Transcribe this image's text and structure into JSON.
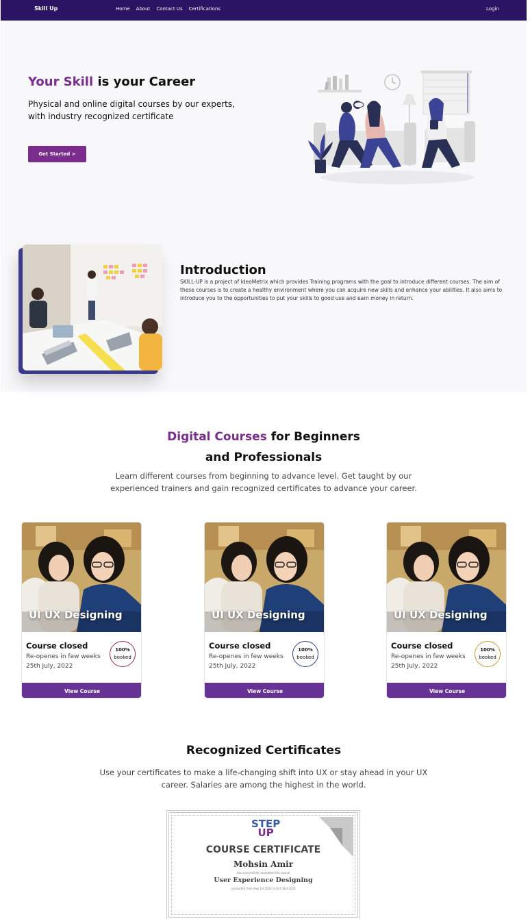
{
  "nav": {
    "brand": "Skill Up",
    "links": [
      "Home",
      "About",
      "Contact Us",
      "Certifications"
    ],
    "login": "Login"
  },
  "hero": {
    "title_accent": "Your Skill",
    "title_rest": "is your Career",
    "subtitle": "Physical and online digital courses by our experts, with industry recognized certificate",
    "cta": "Get Started >"
  },
  "intro": {
    "title": "Introduction",
    "text": "SKILL-UP is a project of IdeoMetrix which provides Training programs with the goal to introduce different courses. The aim of these courses is to create a healthy environment where you can acquire new skills and enhance your abilities. It also aims to introduce you to the opportunities to put your skills to good use and earn money in return."
  },
  "courses": {
    "title_accent": "Digital Courses",
    "title_rest": "for Beginners",
    "title_line2": "and Professionals",
    "subtitle": "Learn different courses from beginning to advance level. Get taught by our experienced trainers and gain recognized certificates to advance your career.",
    "cards": [
      {
        "label": "UI UX Designing",
        "status": "Course closed",
        "reopen": "Re-openes in few weeks",
        "date": "25th July, 2022",
        "badge_pct": "100%",
        "badge_text": "booked",
        "badge_color": "#a0263a",
        "button": "View Course"
      },
      {
        "label": "UI UX Designing",
        "status": "Course closed",
        "reopen": "Re-openes in few weeks",
        "date": "25th July, 2022",
        "badge_pct": "100%",
        "badge_text": "booked",
        "badge_color": "#2b3f8c",
        "button": "View Course"
      },
      {
        "label": "UI UX Designing",
        "status": "Course closed",
        "reopen": "Re-openes in few weeks",
        "date": "25th July, 2022",
        "badge_pct": "100%",
        "badge_text": "booked",
        "badge_color": "#c9962a",
        "button": "View Course"
      }
    ]
  },
  "certificates": {
    "title": "Recognized Certificates",
    "subtitle": "Use your certificates to make a life-changing shift into UX or stay ahead in your UX career. Salaries are among the highest in the world.",
    "sample": {
      "logo_top": "STEP",
      "logo_bottom": "UP",
      "heading": "COURSE CERTIFICATE",
      "name": "Mohsin Amir",
      "line1": "has successfully completed the course",
      "course": "User Experience Designing",
      "line2": "conducted from Aug 1st 2022 to Oct 31st 2022"
    }
  },
  "colors": {
    "nav_bg": "#2b1463",
    "accent": "#7b2d8e",
    "button": "#673295"
  }
}
